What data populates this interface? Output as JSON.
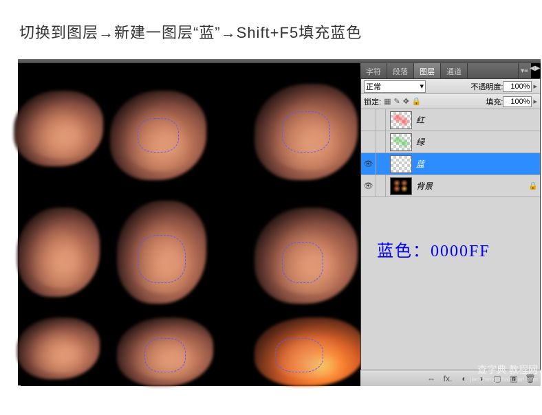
{
  "instruction": "切换到图层→新建一图层“蓝”→Shift+F5填充蓝色",
  "tabs": {
    "char": "字符",
    "para": "段落",
    "layers": "图层",
    "channels": "通道"
  },
  "blend": {
    "label": "正常",
    "opacity_label": "不透明度:",
    "opacity_value": "100%",
    "lock_label": "锁定:",
    "fill_label": "填充:",
    "fill_value": "100%"
  },
  "layers": [
    {
      "name": "红",
      "visible": false,
      "selected": false,
      "thumb": "red",
      "locked": false
    },
    {
      "name": "绿",
      "visible": false,
      "selected": false,
      "thumb": "green",
      "locked": false
    },
    {
      "name": "蓝",
      "visible": true,
      "selected": true,
      "thumb": "plain",
      "locked": false
    },
    {
      "name": "背景",
      "visible": true,
      "selected": false,
      "thumb": "bg",
      "locked": true
    }
  ],
  "color_note": "蓝色：0000FF",
  "footer_icons": {
    "link": "⇔",
    "fx": "fx.",
    "mask": "◐",
    "adjust": "◑",
    "folder": "▢",
    "new": "▣",
    "trash": "🗑"
  },
  "watermark": {
    "main": "查字典 教程网",
    "sub": "jiaocheng.chazidian.com"
  }
}
